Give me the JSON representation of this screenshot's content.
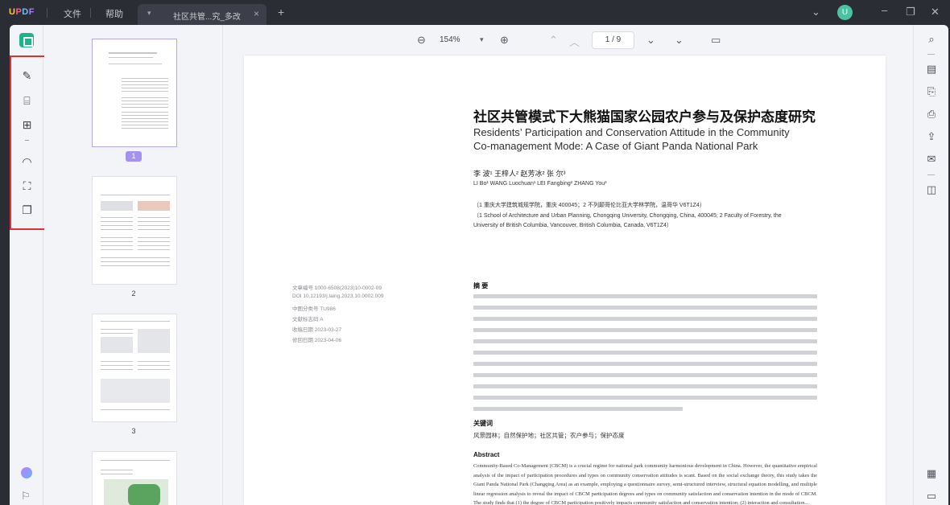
{
  "app": {
    "logo": [
      "U",
      "P",
      "D",
      "F"
    ],
    "menu": [
      "文件",
      "帮助"
    ],
    "tab_label": "社区共管...究_多改",
    "tab_close": "×",
    "new_tab": "+",
    "avatar_initial": "U"
  },
  "toolbar": {
    "zoom": "154%",
    "page_indicator": "1 / 9"
  },
  "thumbnails": [
    {
      "page": "1",
      "selected": true
    },
    {
      "page": "2",
      "selected": false
    },
    {
      "page": "3",
      "selected": false
    }
  ],
  "document": {
    "title_cn": "社区共管模式下大熊猫国家公园农户参与及保护态度研究",
    "title_en_line1": "Residents’ Participation and Conservation Attitude in the Community",
    "title_en_line2": "Co-management Mode: A Case of Giant Panda National Park",
    "authors_cn": "李 波¹ 王梓人² 赵芳冰² 张 尔³",
    "authors_en": "LI Bo¹ WANG Luochuan¹ LEI Fangbing² ZHANG You³",
    "affil_cn": "（1 重庆大学建筑城规学院，重庆 400045；2 不列颠哥伦比亚大学林学院，温哥华 V6T1Z4）",
    "affil_en_1": "（1 School of Architecture and Urban Planning, Chongqing University, Chongqing, China, 400045; 2 Faculty of Forestry, the",
    "affil_en_2": "University of British Columbia, Vancouver, British Columbia, Canada, V6T1Z4）",
    "meta": [
      "文章编号 1000-6508(2023)10-0002-09",
      "DOI 10.12193/j.laing.2023.10.0002.009",
      "中图分类号 TU986",
      "文献标志码 A",
      "收稿日期 2023-03-27",
      "修回日期 2023-04-06"
    ],
    "abstract_heading_cn": "摘 要",
    "keywords_heading": "关键词",
    "keywords": "风景园林；自然保护地；社区共管；农户参与；保护态度",
    "abstract_heading_en": "Abstract",
    "abstract_en": "Community-Based Co-Management (CBCM) is a crucial regime for national park community harmonious development in China. However, the quantitative empirical analysis of the impact of participation procedures and types on community conservation attitudes is scant. Based on the social exchange theory, this study takes the Giant Panda National Park (Changqing Area) as an example, employing a questionnaire survey, semi-structured interview, structural equation modelling, and multiple linear regression analysis to reveal the impact of CBCM participation degrees and types on community satisfaction and conservation intention in the mode of CBCM. The study finds that (1) the degree of CBCM participation positively impacts community satisfaction and conservation intention; (2) interaction and consultation..."
  }
}
